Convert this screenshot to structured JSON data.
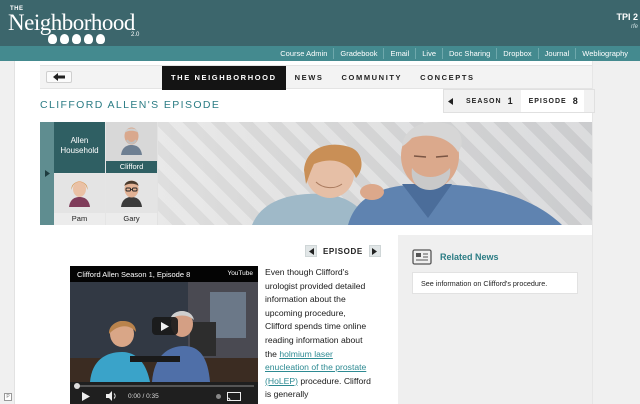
{
  "header": {
    "logo_the": "THE",
    "logo_main": "Neighborhood",
    "logo_version": "2.0",
    "user_tag": "TPI 2",
    "user_sub": "rfe"
  },
  "topnav": [
    "Course Admin",
    "Gradebook",
    "Email",
    "Live",
    "Doc Sharing",
    "Dropbox",
    "Journal",
    "Webliography"
  ],
  "subnav": {
    "tabs": [
      "THE NEIGHBORHOOD",
      "NEWS",
      "COMMUNITY",
      "CONCEPTS"
    ],
    "active_index": 0
  },
  "page": {
    "title": "CLIFFORD ALLEN'S EPISODE",
    "season_label": "SEASON",
    "season_value": "1",
    "episode_label": "EPISODE",
    "episode_value": "8"
  },
  "cast": {
    "household": "Allen Household",
    "members": [
      "Clifford",
      "Pam",
      "Gary"
    ]
  },
  "episode_nav": {
    "label": "EPISODE"
  },
  "video": {
    "title": "Clifford Allen Season 1, Episode 8",
    "brand": "YouTube",
    "time": "0:00 / 0:35",
    "progress": 0
  },
  "article": {
    "text_before": "Even though Clifford's urologist provided detailed information about the upcoming procedure, Clifford spends time online reading information about the ",
    "link": "holmium laser enucleation of the prostate (HoLEP)",
    "text_after": " procedure. Clifford is generally"
  },
  "related": {
    "title": "Related News",
    "items": [
      "See information on Clifford's procedure."
    ]
  },
  "colors": {
    "header_bg": "#3c666c",
    "nav_bg": "#448a8f",
    "accent": "#2b7c84",
    "active_tab": "#141414"
  }
}
